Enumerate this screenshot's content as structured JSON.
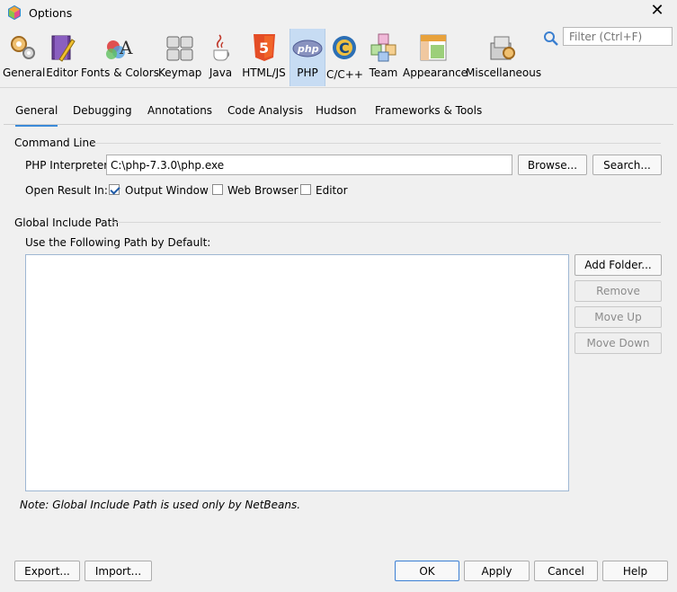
{
  "window": {
    "title": "Options"
  },
  "categories": [
    {
      "label": "General",
      "icon": "gears-icon"
    },
    {
      "label": "Editor",
      "icon": "editor-icon"
    },
    {
      "label": "Fonts & Colors",
      "icon": "fonts-colors-icon"
    },
    {
      "label": "Keymap",
      "icon": "keymap-icon"
    },
    {
      "label": "Java",
      "icon": "java-icon"
    },
    {
      "label": "HTML/JS",
      "icon": "html5-icon"
    },
    {
      "label": "PHP",
      "icon": "php-icon",
      "selected": true
    },
    {
      "label": "C/C++",
      "icon": "cpp-icon"
    },
    {
      "label": "Team",
      "icon": "team-icon"
    },
    {
      "label": "Appearance",
      "icon": "appearance-icon"
    },
    {
      "label": "Miscellaneous",
      "icon": "miscellaneous-icon"
    }
  ],
  "search": {
    "placeholder": "Filter (Ctrl+F)"
  },
  "tabs": [
    {
      "label": "General",
      "selected": true
    },
    {
      "label": "Debugging"
    },
    {
      "label": "Annotations"
    },
    {
      "label": "Code Analysis"
    },
    {
      "label": "Hudson"
    },
    {
      "label": "Frameworks & Tools"
    }
  ],
  "command_line": {
    "section_title": "Command Line",
    "interpreter_label": "PHP Interpreter:",
    "interpreter_value": "C:\\php-7.3.0\\php.exe",
    "browse_label": "Browse...",
    "search_label": "Search...",
    "open_result_label": "Open Result In:",
    "options": [
      {
        "label": "Output Window",
        "checked": true
      },
      {
        "label": "Web Browser",
        "checked": false
      },
      {
        "label": "Editor",
        "checked": false
      }
    ]
  },
  "include_path": {
    "section_title": "Global Include Path",
    "list_label": "Use the Following Path by Default:",
    "paths": [],
    "buttons": [
      {
        "label": "Add Folder...",
        "enabled": true
      },
      {
        "label": "Remove",
        "enabled": false
      },
      {
        "label": "Move Up",
        "enabled": false
      },
      {
        "label": "Move Down",
        "enabled": false
      }
    ],
    "note": "Note: Global Include Path is used only by NetBeans."
  },
  "footer": {
    "export_label": "Export...",
    "import_label": "Import...",
    "ok_label": "OK",
    "apply_label": "Apply",
    "cancel_label": "Cancel",
    "help_label": "Help"
  },
  "colors": {
    "accent": "#3b8ad8",
    "selected_category": "#c7dcf3"
  }
}
